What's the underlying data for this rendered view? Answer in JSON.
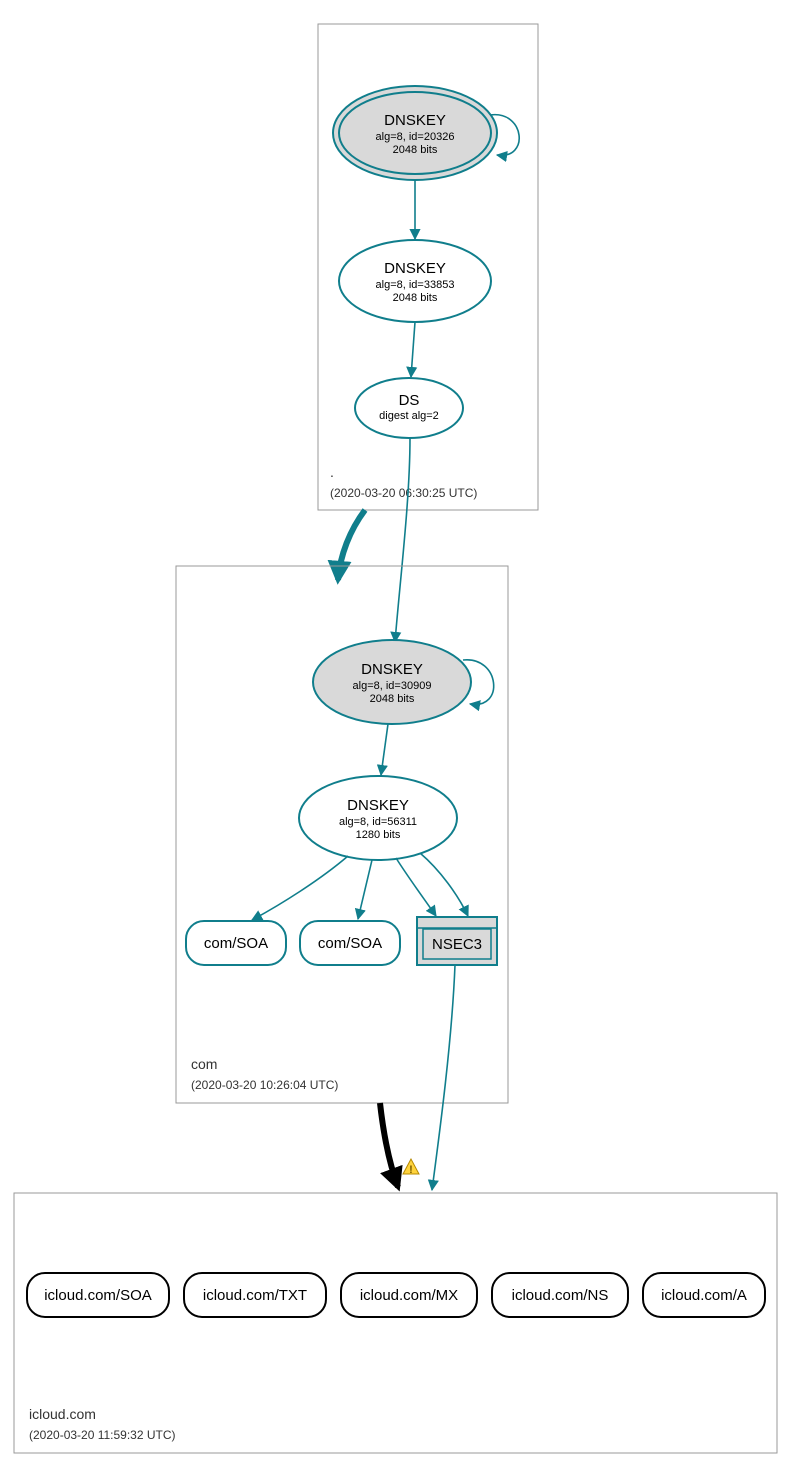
{
  "zones": {
    "root": {
      "name": ".",
      "timestamp": "(2020-03-20 06:30:25 UTC)"
    },
    "com": {
      "name": "com",
      "timestamp": "(2020-03-20 10:26:04 UTC)"
    },
    "icloud": {
      "name": "icloud.com",
      "timestamp": "(2020-03-20 11:59:32 UTC)"
    }
  },
  "nodes": {
    "root_ksk": {
      "title": "DNSKEY",
      "sub1": "alg=8, id=20326",
      "sub2": "2048 bits"
    },
    "root_zsk": {
      "title": "DNSKEY",
      "sub1": "alg=8, id=33853",
      "sub2": "2048 bits"
    },
    "root_ds": {
      "title": "DS",
      "sub1": "digest alg=2"
    },
    "com_ksk": {
      "title": "DNSKEY",
      "sub1": "alg=8, id=30909",
      "sub2": "2048 bits"
    },
    "com_zsk": {
      "title": "DNSKEY",
      "sub1": "alg=8, id=56311",
      "sub2": "1280 bits"
    },
    "com_soa1": {
      "label": "com/SOA"
    },
    "com_soa2": {
      "label": "com/SOA"
    },
    "com_nsec3": {
      "label": "NSEC3"
    },
    "ic_soa": {
      "label": "icloud.com/SOA"
    },
    "ic_txt": {
      "label": "icloud.com/TXT"
    },
    "ic_mx": {
      "label": "icloud.com/MX"
    },
    "ic_ns": {
      "label": "icloud.com/NS"
    },
    "ic_a": {
      "label": "icloud.com/A"
    }
  },
  "colors": {
    "teal": "#107e8c",
    "node_fill": "#d9d9d9",
    "box": "#999999"
  }
}
